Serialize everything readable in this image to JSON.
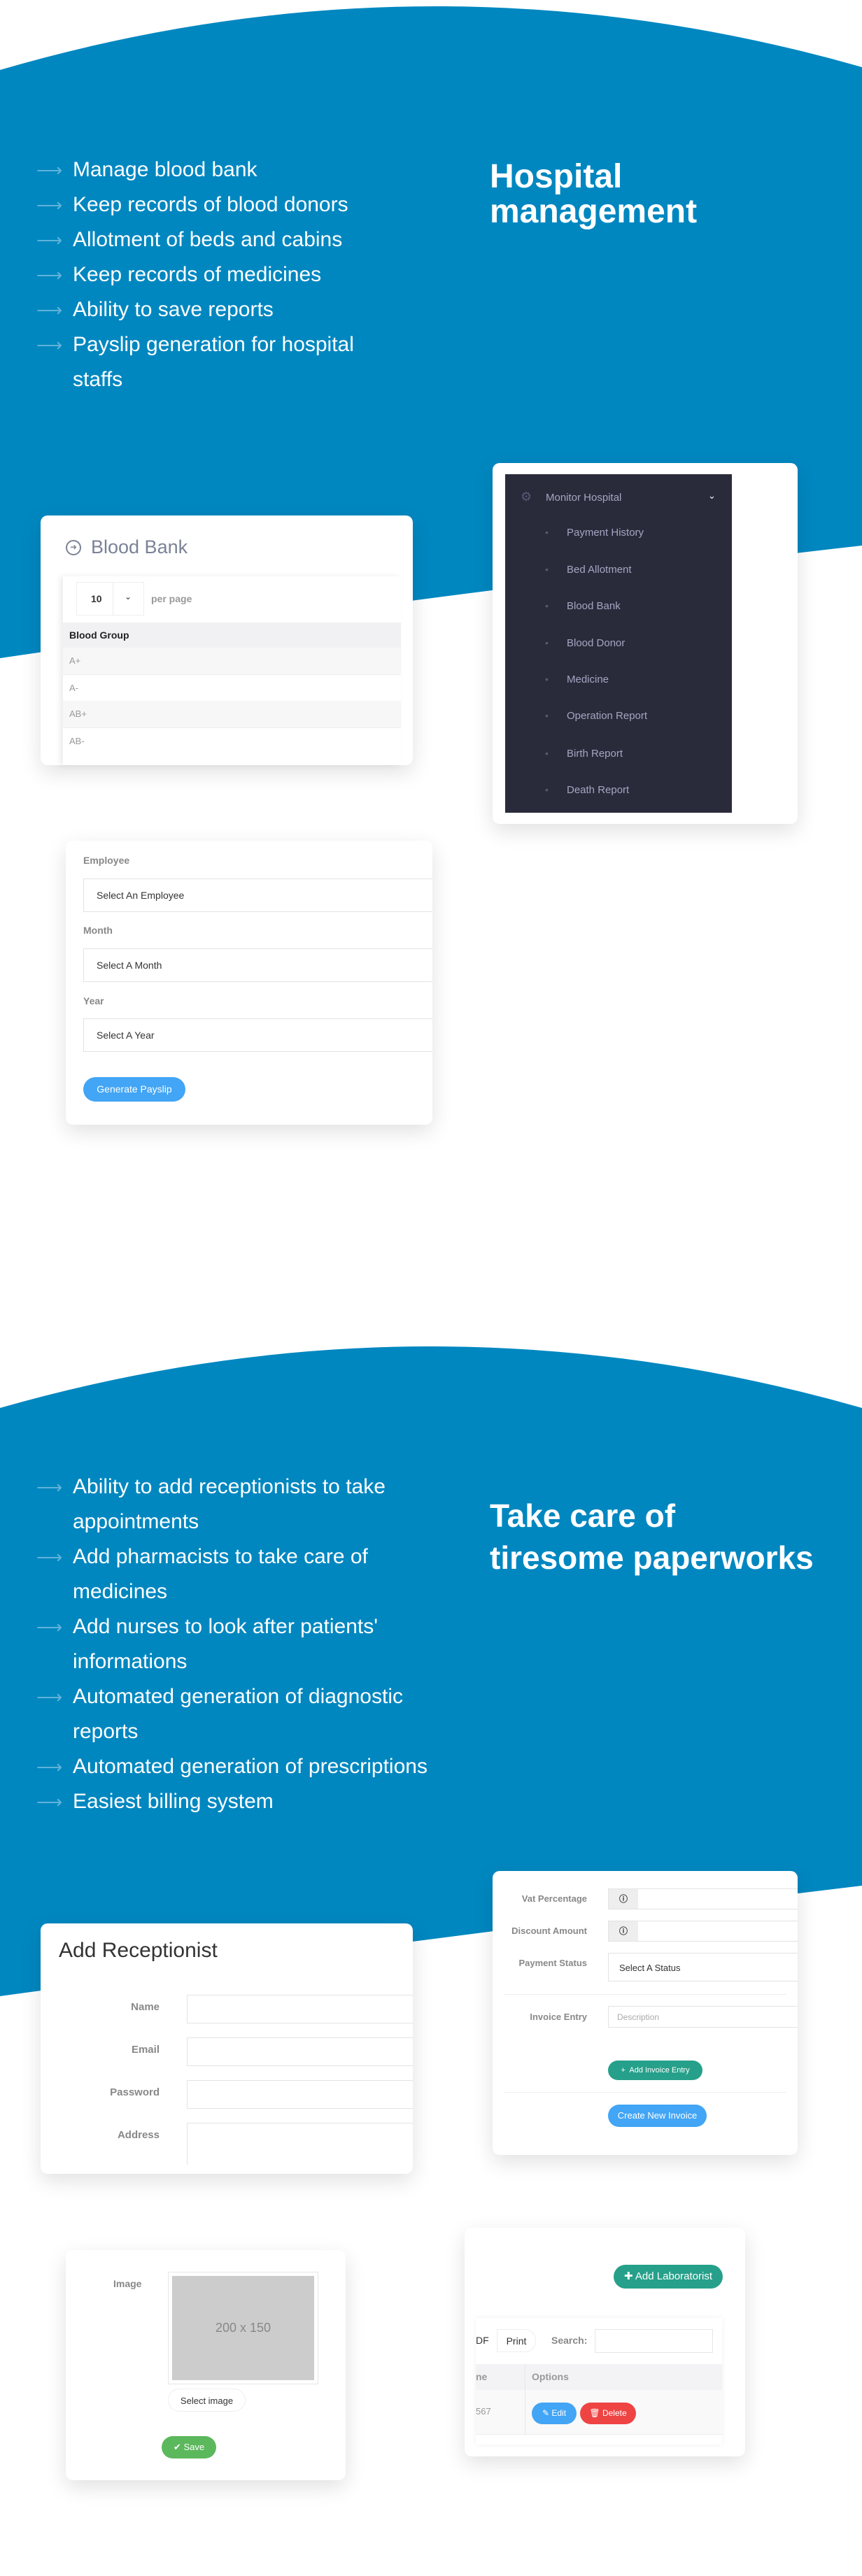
{
  "colors": {
    "brand_blue": "#0087c0",
    "sidebar_bg": "#2a2b3a",
    "primary_button": "#42a5f5",
    "teal_button": "#26a08a",
    "success": "#5cb85c",
    "danger": "#ef4444"
  },
  "section1": {
    "title_line1": "Hospital",
    "title_line2": "management",
    "bullets": [
      "Manage blood bank",
      "Keep records of blood donors",
      "Allotment of beds and cabins",
      "Keep records of medicines",
      "Ability to save reports",
      "Payslip generation for hospital staffs"
    ],
    "blood_bank": {
      "icon": "arrow-circle-right-icon",
      "title": "Blood Bank",
      "per_page_value": "10",
      "per_page_label": "per page",
      "column": "Blood Group",
      "rows": [
        "A+",
        "A-",
        "AB+",
        "AB-"
      ]
    },
    "sidebar": {
      "parent_icon": "gear-icon",
      "parent": "Monitor Hospital",
      "items": [
        "Payment History",
        "Bed Allotment",
        "Blood Bank",
        "Blood Donor",
        "Medicine",
        "Operation Report",
        "Birth Report",
        "Death Report"
      ]
    },
    "payslip": {
      "employee_label": "Employee",
      "employee_value": "Select An Employee",
      "month_label": "Month",
      "month_value": "Select A Month",
      "year_label": "Year",
      "year_value": "Select A Year",
      "button": "Generate Payslip"
    }
  },
  "section2": {
    "title_line1": "Take care of",
    "title_line2": "tiresome paperworks",
    "bullets": [
      "Ability to add receptionists to take appointments",
      "Add pharmacists to take care of medicines",
      "Add nurses to look after patients' informations",
      "Automated generation of diagnostic reports",
      "Automated generation of prescriptions",
      "Easiest billing system"
    ],
    "receptionist": {
      "title": "Add Receptionist",
      "fields": [
        "Name",
        "Email",
        "Password",
        "Address"
      ]
    },
    "invoice": {
      "vat_label": "Vat Percentage",
      "discount_label": "Discount Amount",
      "payment_label": "Payment Status",
      "payment_value": "Select A Status",
      "entry_label": "Invoice Entry",
      "entry_placeholder": "Description",
      "add_entry": "Add Invoice Entry",
      "create": "Create New Invoice"
    },
    "image_form": {
      "label": "Image",
      "placeholder": "200 x 150",
      "select": "Select image",
      "save": "Save"
    },
    "laboratorist": {
      "add": "Add Laboratorist",
      "pdf": "DF",
      "print": "Print",
      "search_label": "Search:",
      "col_name": "ne",
      "col_options": "Options",
      "cell": "567",
      "edit": "Edit",
      "delete": "Delete"
    }
  }
}
